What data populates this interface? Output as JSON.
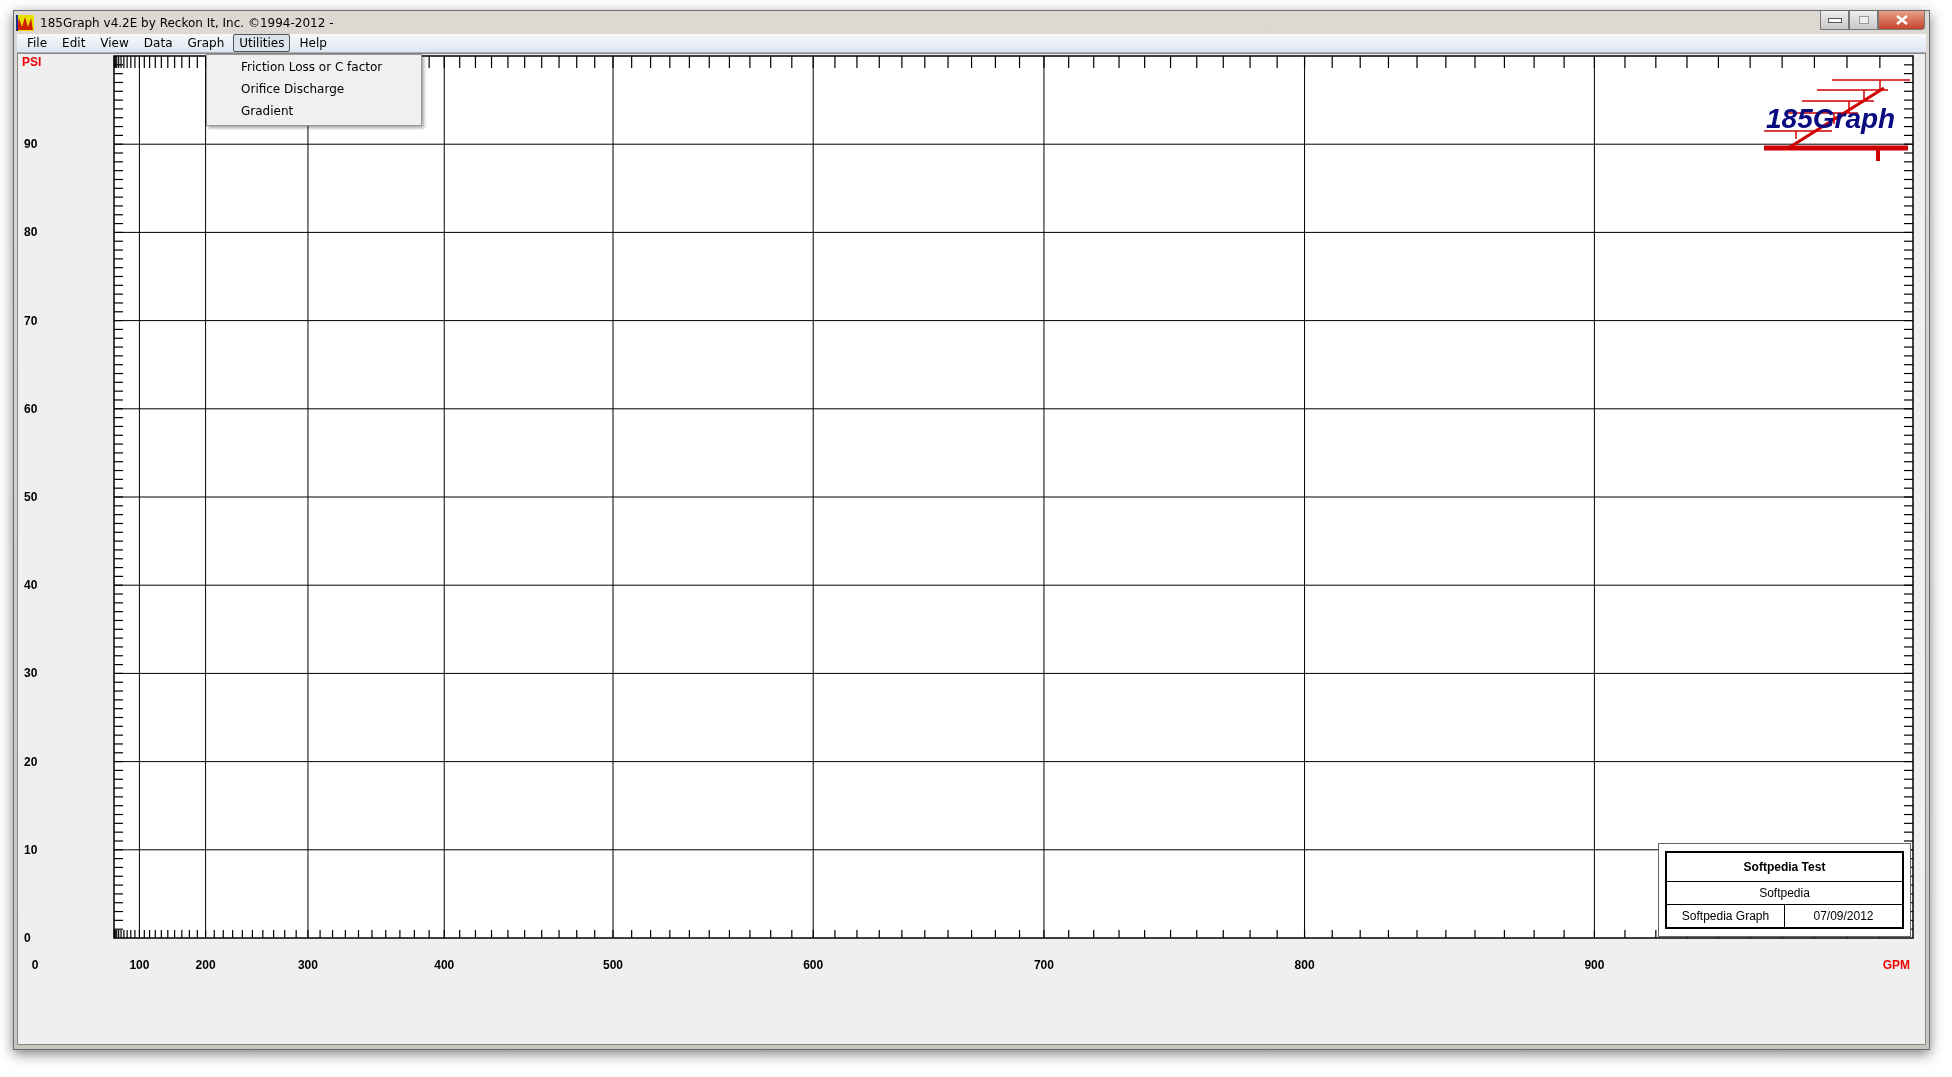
{
  "window": {
    "title": "185Graph v4.2E by Reckon It, Inc. ©1994-2012 -"
  },
  "menu": [
    {
      "label": "File",
      "selected": false
    },
    {
      "label": "Edit",
      "selected": false
    },
    {
      "label": "View",
      "selected": false
    },
    {
      "label": "Data",
      "selected": false
    },
    {
      "label": "Graph",
      "selected": false
    },
    {
      "label": "Utilities",
      "selected": true
    },
    {
      "label": "Help",
      "selected": false
    }
  ],
  "dropdown": {
    "items": [
      "Friction Loss or C factor",
      "Orifice Discharge",
      "Gradient"
    ]
  },
  "graph": {
    "y_unit": "PSI",
    "x_unit": "GPM",
    "y_labels": [
      "90",
      "80",
      "70",
      "60",
      "50",
      "40",
      "30",
      "20",
      "10",
      "0"
    ],
    "x_labels": [
      "0",
      "100",
      "200",
      "300",
      "400",
      "500",
      "600",
      "700",
      "800",
      "900"
    ]
  },
  "logo": {
    "text": "185Graph"
  },
  "title_block": {
    "title": "Softpedia Test",
    "subtitle": "Softpedia",
    "name": "Softpedia Graph",
    "date": "07/09/2012"
  }
}
